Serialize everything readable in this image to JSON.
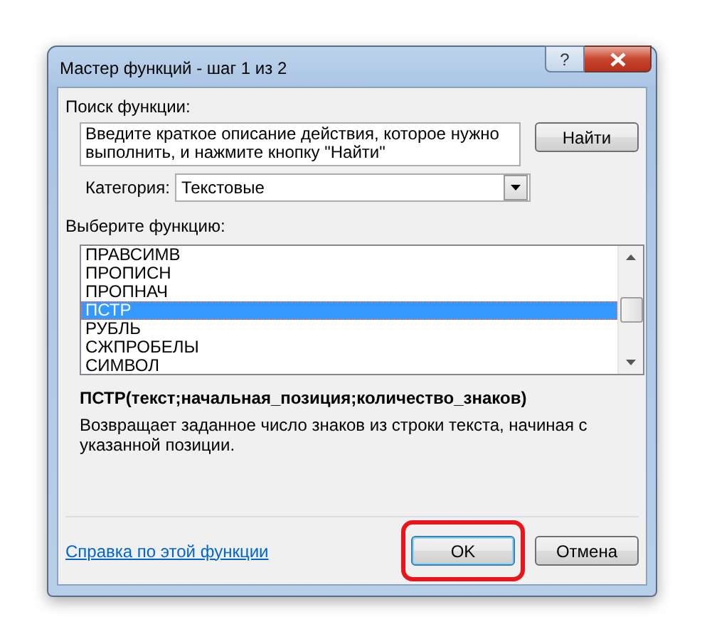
{
  "window": {
    "title": "Мастер функций - шаг 1 из 2",
    "help": "?"
  },
  "search": {
    "label": "Поиск функции:",
    "value": "Введите краткое описание действия, которое нужно выполнить, и нажмите кнопку \"Найти\"",
    "button": "Найти"
  },
  "category": {
    "label": "Категория:",
    "value": "Текстовые"
  },
  "functions": {
    "label": "Выберите функцию:",
    "items": [
      {
        "name": "ПРАВСИМВ",
        "selected": false
      },
      {
        "name": "ПРОПИСН",
        "selected": false
      },
      {
        "name": "ПРОПНАЧ",
        "selected": false
      },
      {
        "name": "ПСТР",
        "selected": true
      },
      {
        "name": "РУБЛЬ",
        "selected": false
      },
      {
        "name": "СЖПРОБЕЛЫ",
        "selected": false
      },
      {
        "name": "СИМВОЛ",
        "selected": false
      }
    ]
  },
  "signature": "ПСТР(текст;начальная_позиция;количество_знаков)",
  "description": "Возвращает заданное число знаков из строки текста, начиная с указанной позиции.",
  "help_link": "Справка по этой функции",
  "buttons": [
    {
      "label": "OK",
      "default": true,
      "highlighted": true
    },
    {
      "label": "Отмена",
      "default": false,
      "highlighted": false
    }
  ]
}
